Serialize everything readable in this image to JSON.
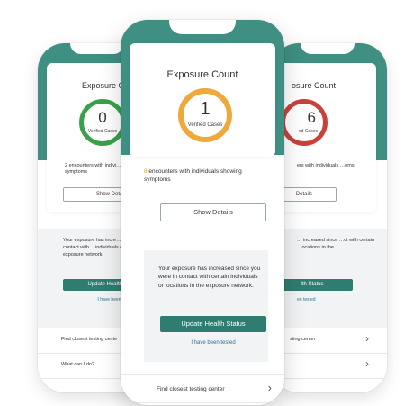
{
  "colors": {
    "teal": "#3f8f83",
    "button": "#2f7c70",
    "green": "#3aa14a",
    "orange": "#efa83a",
    "red": "#c8423c"
  },
  "left": {
    "title": "Exposure Co",
    "count": "0",
    "caption": "Verified Cases",
    "encounters": "2 encounters with indivi… showing symptoms",
    "show_details": "Show Detail",
    "message": "Your exposure has incre… you were in contact with… individuals or locations i… exposure network.",
    "update_btn": "Update Health Sta",
    "tested_link": "I have been tested",
    "row1": "Find closest testing cente",
    "row2": "What can I do?"
  },
  "center": {
    "title": "Exposure Count",
    "count": "1",
    "caption": "Verified Cases",
    "enc_num": "8",
    "enc_rest": " encounters with individuals showing symptoms",
    "show_details": "Show Details",
    "message": "Your exposure has increased since you were in contact with certain individuals or locations in the exposure network.",
    "update_btn": "Update Health Status",
    "tested_link": "I have been tested",
    "row1": "Find closest testing center",
    "chevron": "›"
  },
  "right": {
    "title": "osure Count",
    "count": "6",
    "caption": "ed Cases",
    "encounters": "ers with individuals …oms",
    "show_details": "Details",
    "message": "… increased since …ct with certain …ocations in the",
    "update_btn": "lth Status",
    "tested_link": "en tested",
    "row1": "sting center",
    "chevron": "›"
  }
}
